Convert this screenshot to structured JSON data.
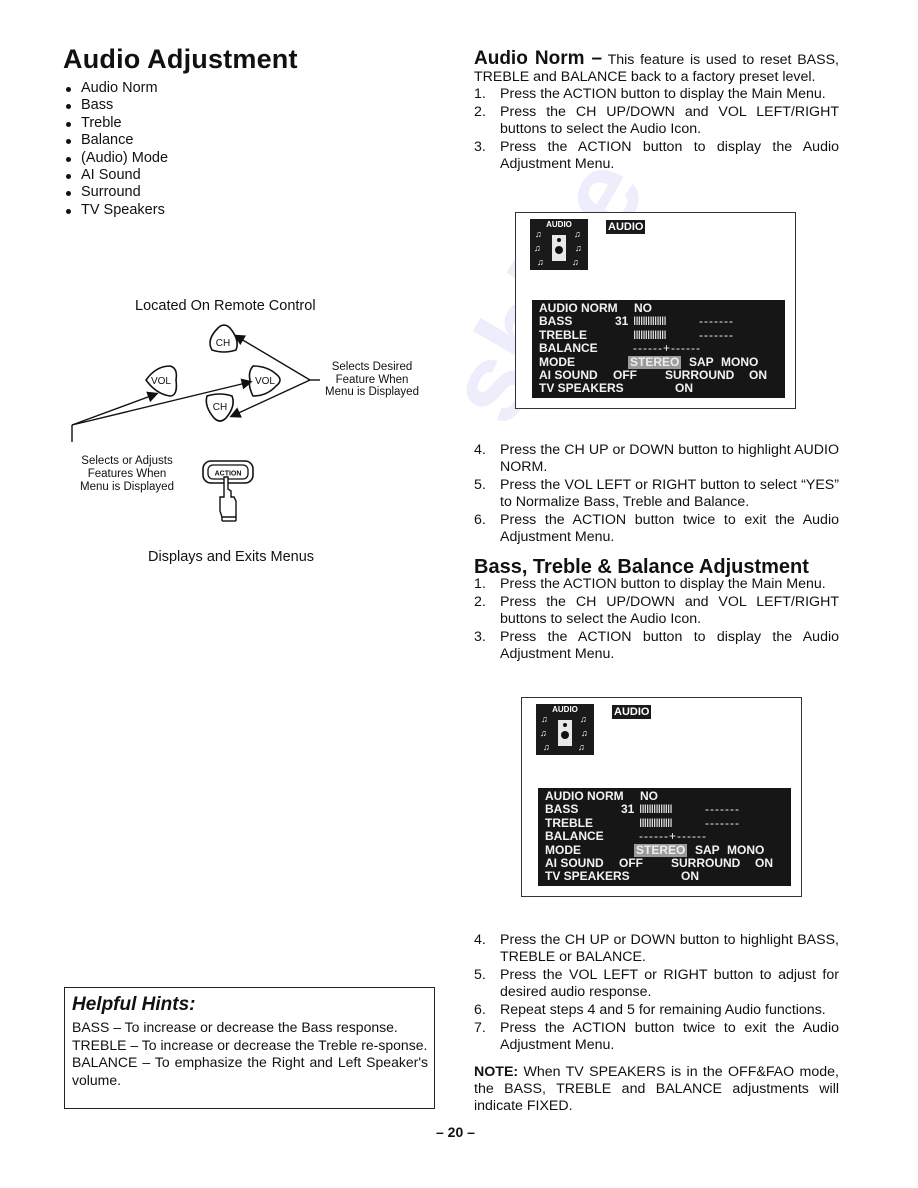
{
  "left": {
    "title": "Audio Adjustment",
    "features": [
      "Audio Norm",
      "Bass",
      "Treble",
      "Balance",
      "(Audio) Mode",
      "AI Sound",
      "Surround",
      "TV Speakers"
    ],
    "remote": {
      "caption": "Located On Remote Control",
      "buttons": {
        "ch_up": "CH",
        "ch_down": "CH",
        "vol_left": "VOL",
        "vol_right": "VOL",
        "action": "ACTION"
      },
      "selects_desired": [
        "Selects Desired",
        "Feature When",
        "Menu is Displayed"
      ],
      "selects_adjusts": [
        "Selects or Adjusts",
        "Features When",
        "Menu is Displayed"
      ],
      "displays_exits": "Displays and Exits Menus"
    },
    "hints": {
      "title": "Helpful Hints:",
      "items": [
        "BASS – To increase or decrease the Bass response.",
        "TREBLE – To increase or decrease the Treble re-sponse.",
        "BALANCE – To emphasize the Right and Left Speaker's volume."
      ]
    }
  },
  "right": {
    "audio_norm": {
      "heading": "Audio Norm –",
      "intro": "This feature is used to reset BASS, TREBLE and BALANCE back to a factory preset level.",
      "steps_a": [
        {
          "num": "1.",
          "text": "Press the ACTION button to display the Main Menu."
        },
        {
          "num": "2.",
          "text": "Press the CH UP/DOWN and VOL LEFT/RIGHT buttons to select the Audio Icon."
        },
        {
          "num": "3.",
          "text": "Press the ACTION button to display the Audio Adjustment Menu."
        }
      ],
      "steps_b": [
        {
          "num": "4.",
          "text": "Press the CH UP or DOWN button to highlight AUDIO NORM."
        },
        {
          "num": "5.",
          "text": "Press the VOL LEFT or RIGHT button to select “YES” to Normalize Bass, Treble and Balance."
        },
        {
          "num": "6.",
          "text": "Press the ACTION button twice to exit the Audio Adjustment Menu."
        }
      ]
    },
    "bass_treble": {
      "heading": "Bass, Treble & Balance Adjustment",
      "steps_a": [
        {
          "num": "1.",
          "text": "Press the ACTION button to display the Main Menu."
        },
        {
          "num": "2.",
          "text": "Press the CH UP/DOWN and VOL LEFT/RIGHT buttons to select the Audio Icon."
        },
        {
          "num": "3.",
          "text": "Press the ACTION button to display the Audio Adjustment Menu."
        }
      ],
      "steps_b": [
        {
          "num": "4.",
          "text": "Press the CH UP or DOWN button to highlight BASS, TREBLE or BALANCE."
        },
        {
          "num": "5.",
          "text": "Press the VOL LEFT or RIGHT button to adjust for desired audio response."
        },
        {
          "num": "6.",
          "text": "Repeat steps 4 and 5 for remaining Audio functions."
        },
        {
          "num": "7.",
          "text": "Press the ACTION button twice to exit the Audio Adjustment Menu."
        }
      ]
    },
    "note": {
      "label": "NOTE:",
      "text": " When TV SPEAKERS is in the OFF&FAO mode, the BASS, TREBLE and BALANCE adjustments will indicate FIXED."
    }
  },
  "screen_menu": {
    "icon_label": "AUDIO",
    "tag": "AUDIO",
    "audio_norm_label": "AUDIO NORM",
    "audio_norm_value": "NO",
    "bass_label": "BASS",
    "bass_value": "31",
    "bass_bar": "IIIIIIIIIIIIII",
    "bass_rest": "-------",
    "treble_label": "TREBLE",
    "treble_bar": "IIIIIIIIIIIIII",
    "treble_rest": "-------",
    "balance_label": "BALANCE",
    "balance_bar": "------+------",
    "mode_label": "MODE",
    "mode_options": [
      "STEREO",
      "SAP",
      "MONO"
    ],
    "mode_selected": "STEREO",
    "ai_sound_label": "AI SOUND",
    "ai_sound_value": "OFF",
    "surround_label": "SURROUND",
    "surround_value": "ON",
    "tv_speakers_label": "TV SPEAKERS",
    "tv_speakers_value": "ON"
  },
  "footer": {
    "page_number": "– 20 –"
  }
}
